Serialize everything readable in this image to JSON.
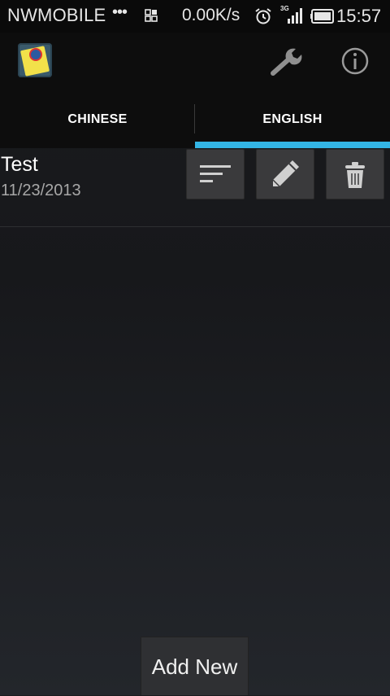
{
  "status_bar": {
    "carrier": "NWMOBILE",
    "dots": "•••",
    "network_speed": "0.00K/s",
    "network_type": "3G",
    "time": "15:57",
    "icons": [
      "grid-icon",
      "alarm-icon",
      "signal-icon",
      "battery-icon"
    ]
  },
  "action_bar": {
    "app_icon": "notebook-app-icon",
    "settings_icon": "wrench-icon",
    "info_icon": "info-icon"
  },
  "tabs": [
    {
      "label": "CHINESE",
      "selected": false
    },
    {
      "label": "ENGLISH",
      "selected": true
    }
  ],
  "list": {
    "items": [
      {
        "title": "Test",
        "date": "11/23/2013",
        "actions": [
          "sort-icon",
          "pencil-icon",
          "trash-icon"
        ]
      }
    ]
  },
  "add_button": {
    "label": "Add New"
  },
  "colors": {
    "accent": "#33b5e5",
    "background": "#1a1b1e",
    "button": "#3a3a3c"
  }
}
